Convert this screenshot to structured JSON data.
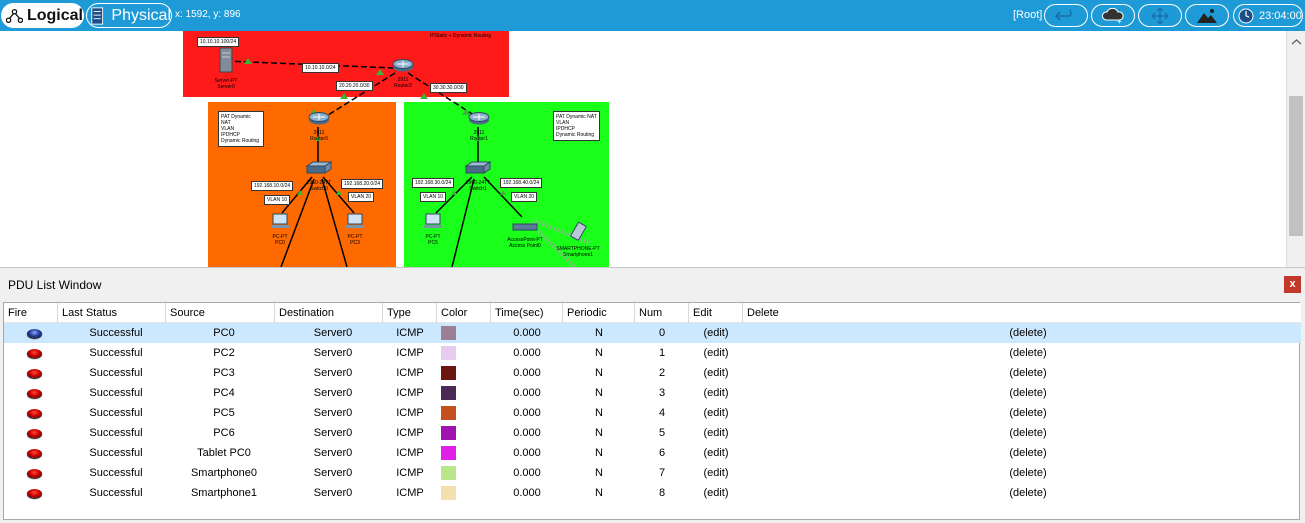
{
  "topbar": {
    "logical_label": "Logical",
    "physical_label": "Physical",
    "coords": "x: 1592, y: 896",
    "root_label": "[Root]",
    "clock": "23:04:00"
  },
  "canvas": {
    "regions": {
      "top_color": "#ff1a1a",
      "left_color": "#ff6a00",
      "right_color": "#1aff1a"
    },
    "notes": {
      "top": "IPStatic + Dynamic Routing",
      "left": [
        "PAT Dynamic NAT",
        "VLAN",
        "IPDHCP",
        "Dynamic Routing"
      ],
      "right": [
        "PAT Dynamic NAT",
        "VLAN",
        "IPDHCP",
        "Dynamic Routing"
      ]
    },
    "labels": {
      "net_server": "10.10.10.100/24",
      "net_link": "10.10.10.0/24",
      "net_r0": "20.20.20.0/30",
      "net_r1": "30.30.30.0/30",
      "net_v10_left": "192.168.10.0/24",
      "net_v20_left": "192.168.20.0/24",
      "vlan10_left": "VLAN 10",
      "vlan20_left": "VLAN 20",
      "net_v30_right": "192.168.30.0/24",
      "net_v40_right": "192.168.40.0/24",
      "vlan10_right": "VLAN 10",
      "vlan20_right": "VLAN 20"
    },
    "devices": {
      "server": [
        "Server-PT",
        "Server0"
      ],
      "router2": [
        "2911",
        "Router2"
      ],
      "router0": [
        "2911",
        "Router0"
      ],
      "router1": [
        "2911",
        "Router1"
      ],
      "switch0": [
        "2960-24TT",
        "Switch0"
      ],
      "switch1": [
        "2960-24TT",
        "Switch1"
      ],
      "pc0": [
        "PC-PT",
        "PC0"
      ],
      "pc3": [
        "PC-PT",
        "PC3"
      ],
      "pc5": [
        "PC-PT",
        "PC5"
      ],
      "ap": [
        "AccessPoint-PT",
        "Access Point0"
      ],
      "smartphone": [
        "SMARTPHONE-PT",
        "Smartphone1"
      ]
    }
  },
  "pdu": {
    "title": "PDU List Window",
    "close_label": "x",
    "columns": [
      "Fire",
      "Last Status",
      "Source",
      "Destination",
      "Type",
      "Color",
      "Time(sec)",
      "Periodic",
      "Num",
      "Edit",
      "Delete"
    ],
    "rows": [
      {
        "status": "Successful",
        "source": "PC0",
        "dest": "Server0",
        "type": "ICMP",
        "color": "#9b7f94",
        "time": "0.000",
        "periodic": "N",
        "num": "0",
        "edit": "(edit)",
        "del": "(delete)",
        "fire": "blue",
        "selected": true
      },
      {
        "status": "Successful",
        "source": "PC2",
        "dest": "Server0",
        "type": "ICMP",
        "color": "#e8ccf0",
        "time": "0.000",
        "periodic": "N",
        "num": "1",
        "edit": "(edit)",
        "del": "(delete)",
        "fire": "red",
        "selected": false
      },
      {
        "status": "Successful",
        "source": "PC3",
        "dest": "Server0",
        "type": "ICMP",
        "color": "#6b1610",
        "time": "0.000",
        "periodic": "N",
        "num": "2",
        "edit": "(edit)",
        "del": "(delete)",
        "fire": "red",
        "selected": false
      },
      {
        "status": "Successful",
        "source": "PC4",
        "dest": "Server0",
        "type": "ICMP",
        "color": "#4a2a55",
        "time": "0.000",
        "periodic": "N",
        "num": "3",
        "edit": "(edit)",
        "del": "(delete)",
        "fire": "red",
        "selected": false
      },
      {
        "status": "Successful",
        "source": "PC5",
        "dest": "Server0",
        "type": "ICMP",
        "color": "#c4501e",
        "time": "0.000",
        "periodic": "N",
        "num": "4",
        "edit": "(edit)",
        "del": "(delete)",
        "fire": "red",
        "selected": false
      },
      {
        "status": "Successful",
        "source": "PC6",
        "dest": "Server0",
        "type": "ICMP",
        "color": "#9f12b0",
        "time": "0.000",
        "periodic": "N",
        "num": "5",
        "edit": "(edit)",
        "del": "(delete)",
        "fire": "red",
        "selected": false
      },
      {
        "status": "Successful",
        "source": "Tablet PC0",
        "dest": "Server0",
        "type": "ICMP",
        "color": "#e020e8",
        "time": "0.000",
        "periodic": "N",
        "num": "6",
        "edit": "(edit)",
        "del": "(delete)",
        "fire": "red",
        "selected": false
      },
      {
        "status": "Successful",
        "source": "Smartphone0",
        "dest": "Server0",
        "type": "ICMP",
        "color": "#b8e688",
        "time": "0.000",
        "periodic": "N",
        "num": "7",
        "edit": "(edit)",
        "del": "(delete)",
        "fire": "red",
        "selected": false
      },
      {
        "status": "Successful",
        "source": "Smartphone1",
        "dest": "Server0",
        "type": "ICMP",
        "color": "#f4dfae",
        "time": "0.000",
        "periodic": "N",
        "num": "8",
        "edit": "(edit)",
        "del": "(delete)",
        "fire": "red",
        "selected": false
      }
    ]
  }
}
